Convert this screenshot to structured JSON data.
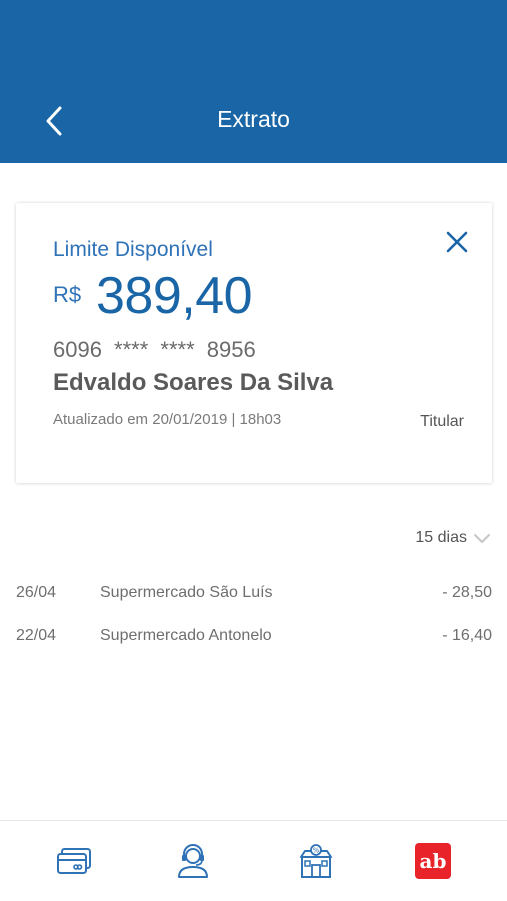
{
  "header": {
    "title": "Extrato",
    "back_icon": "chevron-left-icon"
  },
  "card": {
    "limit_label": "Limite Disponível",
    "currency": "R$",
    "amount": "389,40",
    "card_number": "6096 **** **** 8956",
    "holder_name": "Edvaldo Soares Da Silva",
    "updated_text": "Atualizado em 20/01/2019 | 18h03",
    "role": "Titular",
    "close_icon": "close-icon"
  },
  "filter": {
    "period_label": "15 dias"
  },
  "transactions": [
    {
      "date": "26/04",
      "description": "Supermercado São Luís",
      "value": "- 28,50"
    },
    {
      "date": "22/04",
      "description": "Supermercado Antonelo",
      "value": "- 16,40"
    }
  ],
  "bottom_nav": {
    "items": [
      "card-icon",
      "support-agent-icon",
      "store-icon",
      "ab-logo-icon"
    ],
    "logo_text": "ab"
  },
  "colors": {
    "primary": "#1a65a6",
    "accent_red": "#e8232a"
  }
}
